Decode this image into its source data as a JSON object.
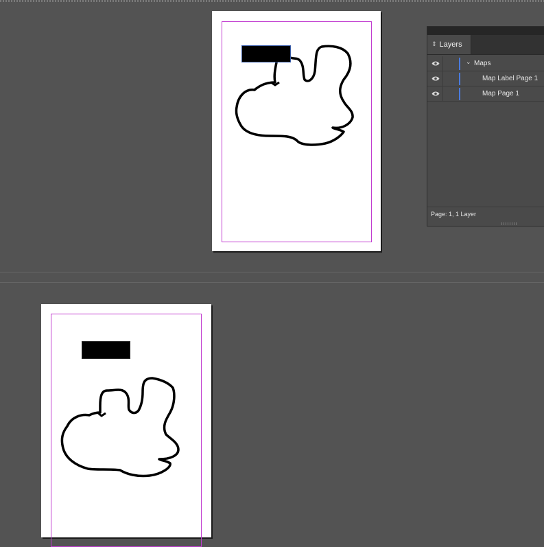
{
  "layers_panel": {
    "tab_label": "Layers",
    "tab_icon": "updown-chevron-icon",
    "layers": [
      {
        "name": "Maps",
        "level": 0,
        "expanded": true,
        "visible": true,
        "color": "#4a7bde"
      },
      {
        "name": "Map Label Page 1",
        "level": 1,
        "visible": true,
        "color": "#4a7bde"
      },
      {
        "name": "Map Page 1",
        "level": 1,
        "visible": true,
        "color": "#4a7bde"
      }
    ],
    "status": "Page: 1, 1 Layer"
  },
  "colors": {
    "pasteboard": "#535353",
    "margin_guide": "#c13cd0",
    "selection": "#4a7bde"
  }
}
